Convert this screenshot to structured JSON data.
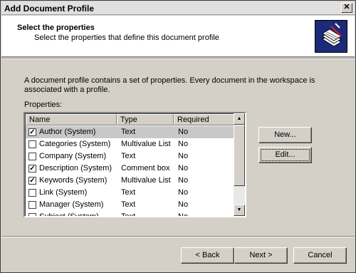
{
  "window": {
    "title": "Add Document Profile"
  },
  "header": {
    "heading": "Select the properties",
    "subheading": "Select the properties that define this document profile"
  },
  "main": {
    "description": "A document profile contains a set of properties. Every document in the workspace is associated with a profile.",
    "properties_label": "Properties:"
  },
  "list": {
    "columns": [
      "Name",
      "Type",
      "Required"
    ],
    "rows": [
      {
        "checked": true,
        "name": "Author (System)",
        "type": "Text",
        "required": "No",
        "selected": true
      },
      {
        "checked": false,
        "name": "Categories (System)",
        "type": "Multivalue List",
        "required": "No"
      },
      {
        "checked": false,
        "name": "Company (System)",
        "type": "Text",
        "required": "No"
      },
      {
        "checked": true,
        "name": "Description (System)",
        "type": "Comment box",
        "required": "No"
      },
      {
        "checked": true,
        "name": "Keywords (System)",
        "type": "Multivalue List",
        "required": "No"
      },
      {
        "checked": false,
        "name": "Link (System)",
        "type": "Text",
        "required": "No"
      },
      {
        "checked": false,
        "name": "Manager (System)",
        "type": "Text",
        "required": "No"
      },
      {
        "checked": false,
        "name": "Subject (System)",
        "type": "Text",
        "required": "No"
      }
    ]
  },
  "buttons": {
    "new": "New...",
    "edit": "Edit...",
    "back": "< Back",
    "next": "Next >",
    "cancel": "Cancel"
  },
  "icons": {
    "close": "close-icon",
    "header": "document-profile-icon"
  },
  "colors": {
    "header_icon_bg": "#1c2a7a",
    "selected_row": "#c8c8c8"
  }
}
